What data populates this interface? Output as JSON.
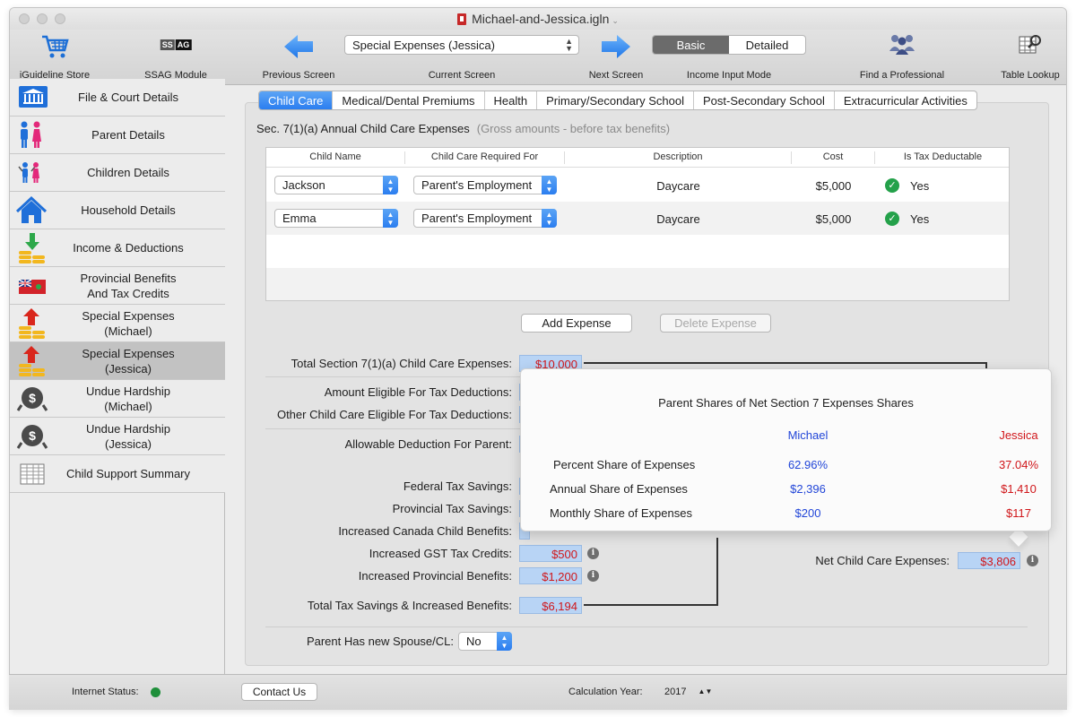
{
  "window": {
    "title": "Michael-and-Jessica.igln"
  },
  "toolbar": {
    "store_label": "iGuideline Store",
    "ssag_label": "SSAG Module",
    "ssag_icon_text_1": "SS",
    "ssag_icon_text_2": "AG",
    "previous_label": "Previous Screen",
    "current_label": "Current Screen",
    "current_value": "Special Expenses (Jessica)",
    "next_label": "Next Screen",
    "mode_label": "Income Input Mode",
    "mode_basic": "Basic",
    "mode_detailed": "Detailed",
    "mode_selected": "Basic",
    "professional_label": "Find a Professional",
    "table_label": "Table Lookup"
  },
  "sidebar": {
    "items": [
      {
        "label": "File & Court Details",
        "icon": "courthouse-icon"
      },
      {
        "label": "Parent Details",
        "icon": "parents-icon"
      },
      {
        "label": "Children Details",
        "icon": "children-icon"
      },
      {
        "label": "Household Details",
        "icon": "house-icon"
      },
      {
        "label": "Income & Deductions",
        "icon": "coins-down-icon"
      },
      {
        "label": "Provincial Benefits\nAnd Tax Credits",
        "icon": "ontario-flag-icon"
      },
      {
        "label": "Special Expenses\n(Michael)",
        "icon": "coins-up-icon"
      },
      {
        "label": "Special Expenses\n(Jessica)",
        "icon": "coins-up-icon"
      },
      {
        "label": "Undue Hardship\n(Michael)",
        "icon": "hardship-icon"
      },
      {
        "label": "Undue Hardship\n(Jessica)",
        "icon": "hardship-icon"
      },
      {
        "label": "Child Support Summary",
        "icon": "summary-sheet-icon"
      }
    ],
    "selected_index": 7
  },
  "tabs": [
    "Child Care",
    "Medical/Dental Premiums",
    "Health",
    "Primary/Secondary School",
    "Post-Secondary School",
    "Extracurricular Activities"
  ],
  "active_tab": "Child Care",
  "section": {
    "heading": "Sec. 7(1)(a)  Annual Child Care Expenses",
    "note": "(Gross amounts - before tax benefits)"
  },
  "table": {
    "headers": [
      "Child Name",
      "Child Care Required For",
      "Description",
      "Cost",
      "Is Tax Deductable"
    ],
    "rows": [
      {
        "child": "Jackson",
        "required_for": "Parent's Employment",
        "description": "Daycare",
        "cost": "$5,000",
        "deductible": "Yes"
      },
      {
        "child": "Emma",
        "required_for": "Parent's Employment",
        "description": "Daycare",
        "cost": "$5,000",
        "deductible": "Yes"
      }
    ]
  },
  "buttons": {
    "add": "Add Expense",
    "delete": "Delete Expense"
  },
  "summary": {
    "total_label": "Total Section 7(1)(a) Child Care Expenses:",
    "total_value": "$10,000",
    "eligible_label": "Amount Eligible For Tax Deductions:",
    "other_label": "Other Child Care Eligible For Tax Deductions:",
    "allowable_label": "Allowable Deduction For Parent:",
    "federal_label": "Federal Tax Savings:",
    "provincial_label": "Provincial Tax Savings:",
    "ccb_label": "Increased Canada Child Benefits:",
    "gst_label": "Increased GST Tax Credits:",
    "gst_value": "$500",
    "prov_benefits_label": "Increased Provincial Benefits:",
    "prov_benefits_value": "$1,200",
    "total_savings_label": "Total Tax Savings & Increased Benefits:",
    "total_savings_value": "$6,194",
    "net_label": "Net Child Care Expenses:",
    "net_value": "$3,806",
    "spouse_label": "Parent Has new Spouse/CL:",
    "spouse_value": "No"
  },
  "popover": {
    "title": "Parent Shares of Net Section 7 Expenses Shares",
    "col_1": "Michael",
    "col_2": "Jessica",
    "rows": [
      {
        "label": "Percent Share of Expenses",
        "michael": "62.96%",
        "jessica": "37.04%"
      },
      {
        "label": "Annual Share of Expenses",
        "michael": "$2,396",
        "jessica": "$1,410"
      },
      {
        "label": "Monthly Share of Expenses",
        "michael": "$200",
        "jessica": "$117"
      }
    ]
  },
  "status": {
    "internet_label": "Internet Status:",
    "contact_label": "Contact Us",
    "year_label": "Calculation Year:",
    "year_value": "2017"
  },
  "colors": {
    "accent_blue": "#2b7ef0",
    "value_red": "#d0161a",
    "share_blue": "#2246d8",
    "status_green": "#1e8f3a"
  }
}
